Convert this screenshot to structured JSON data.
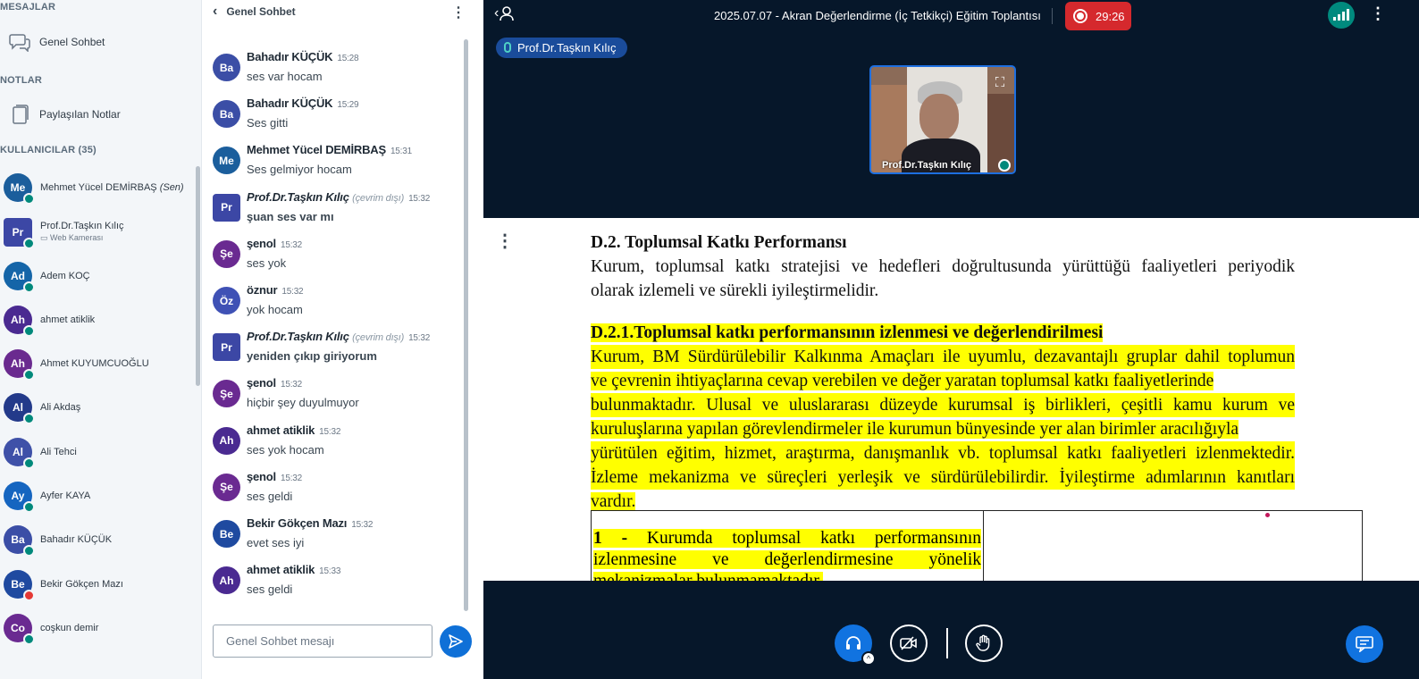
{
  "left": {
    "messages_header": "MESAJLAR",
    "public_chat_label": "Genel Sohbet",
    "notes_header": "NOTLAR",
    "shared_notes_label": "Paylaşılan Notlar",
    "users_header": "KULLANICILAR (35)",
    "users": [
      {
        "initials": "Me",
        "name": "Mehmet Yücel DEMİRBAŞ",
        "tag": "(Sen)",
        "sub": "",
        "color": "#1b5e9c"
      },
      {
        "initials": "Pr",
        "name": "Prof.Dr.Taşkın Kılıç",
        "tag": "",
        "sub": "Web Kamerası",
        "color": "#3c47a5"
      },
      {
        "initials": "Ad",
        "name": "Adem KOÇ",
        "tag": "",
        "sub": "",
        "color": "#1565a8"
      },
      {
        "initials": "Ah",
        "name": "ahmet atiklik",
        "tag": "",
        "sub": "",
        "color": "#4a2a91"
      },
      {
        "initials": "Ah",
        "name": "Ahmet KUYUMCUOĞLU",
        "tag": "",
        "sub": "",
        "color": "#6a2a8f"
      },
      {
        "initials": "Al",
        "name": "Ali Akdaş",
        "tag": "",
        "sub": "",
        "color": "#233a8a"
      },
      {
        "initials": "Al",
        "name": "Ali Tehci",
        "tag": "",
        "sub": "",
        "color": "#3f51a8"
      },
      {
        "initials": "Ay",
        "name": "Ayfer KAYA",
        "tag": "",
        "sub": "",
        "color": "#1565c0"
      },
      {
        "initials": "Ba",
        "name": "Bahadır KÜÇÜK",
        "tag": "",
        "sub": "",
        "color": "#3b4ea6"
      },
      {
        "initials": "Be",
        "name": "Bekir Gökçen Mazı",
        "tag": "",
        "sub": "",
        "color": "#1f4aa0"
      },
      {
        "initials": "Co",
        "name": "coşkun demir",
        "tag": "",
        "sub": "",
        "color": "#6a2a91"
      }
    ]
  },
  "chat": {
    "title": "Genel Sohbet",
    "offline_label": "(çevrim dışı)",
    "messages": [
      {
        "initials": "Ba",
        "name": "Bahadır KÜÇÜK",
        "time": "15:28",
        "text": "ses var hocam",
        "color": "#3b4ea6"
      },
      {
        "initials": "Ba",
        "name": "Bahadır KÜÇÜK",
        "time": "15:29",
        "text": "Ses gitti",
        "color": "#3b4ea6"
      },
      {
        "initials": "Me",
        "name": "Mehmet Yücel DEMİRBAŞ",
        "time": "15:31",
        "text": "Ses gelmiyor hocam",
        "color": "#1b5e9c"
      },
      {
        "initials": "Pr",
        "name": "Prof.Dr.Taşkın Kılıç",
        "time": "15:32",
        "text": "şuan ses var mı",
        "color": "#3c47a5"
      },
      {
        "initials": "Şe",
        "name": "şenol",
        "time": "15:32",
        "text": "ses yok",
        "color": "#6a2a91"
      },
      {
        "initials": "Öz",
        "name": "öznur",
        "time": "15:32",
        "text": "yok hocam",
        "color": "#3f51b5"
      },
      {
        "initials": "Pr",
        "name": "Prof.Dr.Taşkın Kılıç",
        "time": "15:32",
        "text": "yeniden çıkıp giriyorum",
        "color": "#3c47a5"
      },
      {
        "initials": "Şe",
        "name": "şenol",
        "time": "15:32",
        "text": "hiçbir şey duyulmuyor",
        "color": "#6a2a91"
      },
      {
        "initials": "Ah",
        "name": "ahmet atiklik",
        "time": "15:32",
        "text": "ses yok hocam",
        "color": "#4a2a91"
      },
      {
        "initials": "Şe",
        "name": "şenol",
        "time": "15:32",
        "text": "ses geldi",
        "color": "#6a2a91"
      },
      {
        "initials": "Be",
        "name": "Bekir Gökçen Mazı",
        "time": "15:32",
        "text": "evet ses iyi",
        "color": "#1f4aa0"
      },
      {
        "initials": "Ah",
        "name": "ahmet atiklik",
        "time": "15:33",
        "text": "ses geldi",
        "color": "#4a2a91"
      }
    ],
    "input_placeholder": "Genel Sohbet mesajı"
  },
  "meeting": {
    "title": "2025.07.07 - Akran Değerlendirme (İç Tetkikçi) Eğitim Toplantısı",
    "timer": "29:26",
    "talker": "Prof.Dr.Taşkın Kılıç",
    "video_name": "Prof.Dr.Taşkın Kılıç"
  },
  "slide": {
    "heading": "D.2. Toplumsal Katkı Performansı",
    "intro_lines": [
      "Kurum, toplumsal katkı stratejisi ve hedefleri doğrultusunda yürüttüğü faaliyetleri periyodik",
      "olarak  izlemeli ve sürekli iyileştirmelidir."
    ],
    "subheading": "D.2.1.Toplumsal katkı performansının izlenmesi ve değerlendirilmesi",
    "body_lines": [
      "Kurum, BM Sürdürülebilir Kalkınma Amaçları ile uyumlu, dezavantajlı gruplar dahil toplumun",
      "ve  çevrenin ihtiyaçlarına cevap verebilen ve değer yaratan toplumsal katkı faaliyetlerinde",
      "bulunmaktadır. Ulusal ve uluslararası düzeyde kurumsal iş birlikleri, çeşitli kamu kurum ve",
      "kuruluşlarına yapılan görevlendirmeler ile kurumun bünyesinde yer alan birimler aracılığıyla",
      "yürütülen eğitim, hizmet, araştırma, danışmanlık vb. toplumsal katkı faaliyetleri izlenmektedir.",
      "İzleme mekanizma ve süreçleri yerleşik ve sürdürülebilirdir. İyileştirme adımlarının kanıtları",
      "vardır."
    ],
    "table_num": "1 -",
    "table_lines": [
      "Kurumda toplumsal katkı performansının",
      "izlenmesine ve değerlendirmesine yönelik",
      "mekanizmalar bulunmamaktadır."
    ]
  }
}
